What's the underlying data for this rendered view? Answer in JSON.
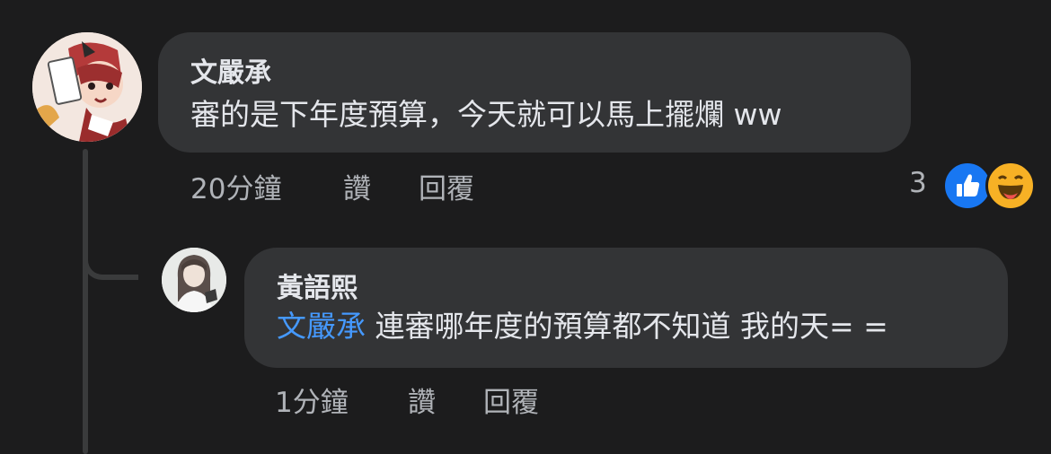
{
  "comments": [
    {
      "author": "文嚴承",
      "text": "審的是下年度預算，今天就可以馬上擺爛 ww",
      "time": "20分鐘",
      "like_label": "讚",
      "reply_label": "回覆",
      "reaction_count": "3",
      "reactions": [
        "like-icon",
        "haha-icon"
      ]
    },
    {
      "author": "黃語熙",
      "mention": "文嚴承",
      "text": " 連審哪年度的預算都不知道 我的天= =",
      "time": "1分鐘",
      "like_label": "讚",
      "reply_label": "回覆"
    }
  ],
  "colors": {
    "background": "#1c1c1d",
    "bubble": "#333436",
    "mention": "#4599ff",
    "like": "#1877f2",
    "haha": "#f7b125"
  }
}
